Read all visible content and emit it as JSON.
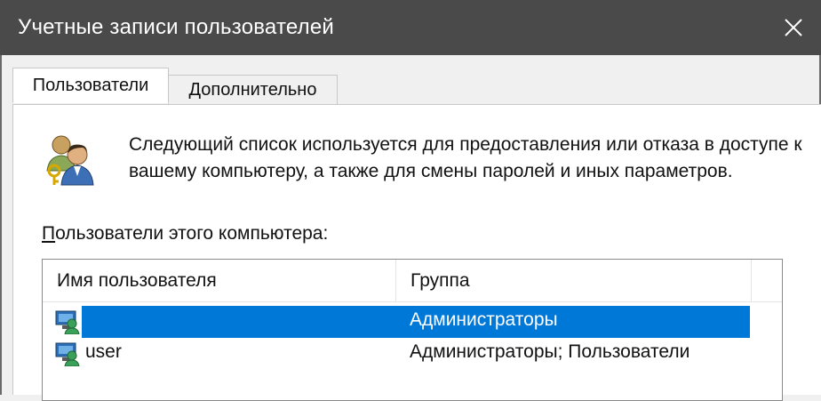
{
  "window": {
    "title": "Учетные записи пользователей",
    "close_label": "✕"
  },
  "tabs": [
    {
      "label": "Пользователи",
      "active": true
    },
    {
      "label": "Дополнительно",
      "active": false
    }
  ],
  "panel": {
    "description": "Следующий список используется для предоставления или отказа в доступе к вашему компьютеру, а также для смены паролей и иных параметров.",
    "list_label_accel": "П",
    "list_label_rest": "ользователи этого компьютера:"
  },
  "listview": {
    "columns": [
      "Имя пользователя",
      "Группа"
    ],
    "rows": [
      {
        "name": "",
        "group": "Администраторы",
        "selected": true
      },
      {
        "name": "user",
        "group": "Администраторы; Пользователи",
        "selected": false
      }
    ]
  },
  "colors": {
    "titlebar": "#4a4a4a",
    "selection": "#0078d7"
  },
  "icons": {
    "header": "users-group-icon",
    "row": "user-computer-icon",
    "close": "close-icon"
  }
}
